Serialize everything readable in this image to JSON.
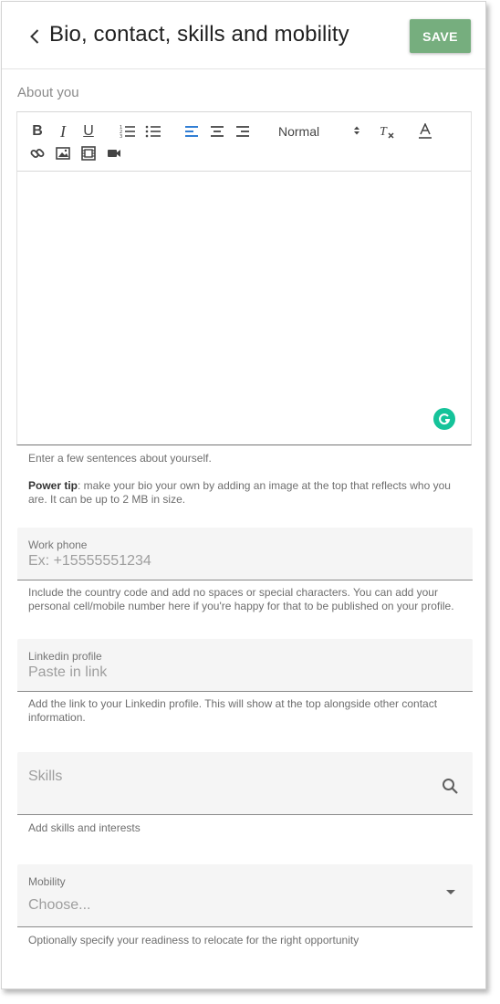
{
  "header": {
    "title": "Bio, contact, skills and mobility",
    "save_label": "SAVE"
  },
  "about": {
    "label": "About you",
    "toolbar": {
      "bold": "B",
      "italic": "I",
      "underline": "U",
      "format_value": "Normal"
    },
    "helper": "Enter a few sentences about yourself.",
    "tip_bold": "Power tip",
    "tip_rest": ": make your bio your own by adding an image at the top that reflects who you are. It can be up to 2 MB in size."
  },
  "work_phone": {
    "label": "Work phone",
    "placeholder": "Ex: +15555551234",
    "helper": "Include the country code and add no spaces or special characters. You can add your personal cell/mobile number here if you're happy for that to be published on your profile."
  },
  "linkedin": {
    "label": "Linkedin profile",
    "placeholder": "Paste in link",
    "helper": "Add the link to your Linkedin profile. This will show at the top alongside other contact information."
  },
  "skills": {
    "placeholder": "Skills",
    "helper": "Add skills and interests"
  },
  "mobility": {
    "label": "Mobility",
    "placeholder": "Choose...",
    "helper": "Optionally specify your readiness to relocate for the right opportunity"
  },
  "colors": {
    "save_button": "#76ae7e",
    "active_align": "#1a6fd0",
    "grammarly": "#15c39a"
  }
}
